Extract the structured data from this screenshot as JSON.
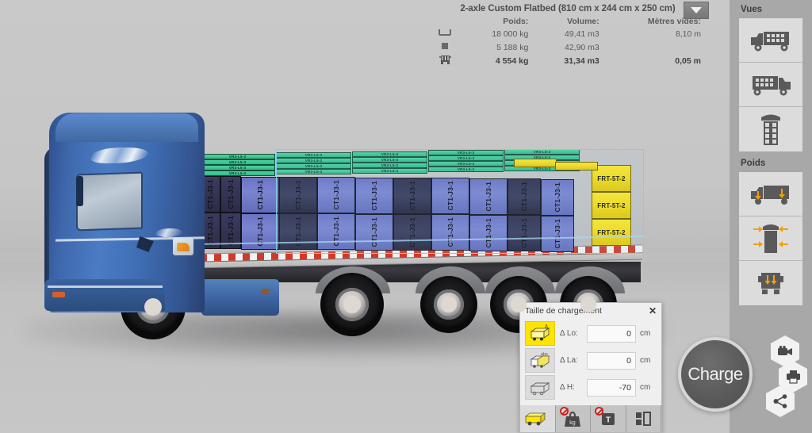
{
  "header": {
    "title": "2-axle Custom Flatbed (810 cm x 244 cm x 250 cm)",
    "columns": [
      "Poids:",
      "Volume:",
      "Mètres vides:"
    ],
    "rows": [
      {
        "icon": "trailer-capacity-icon",
        "poids": "18 000 kg",
        "volume": "49,41 m3",
        "metres": "8,10 m"
      },
      {
        "icon": "cargo-block-icon",
        "poids": "5 188 kg",
        "volume": "42,90 m3",
        "metres": ""
      },
      {
        "icon": "loaded-truck-icon",
        "poids": "4 554 kg",
        "volume": "31,34 m3",
        "metres": "0,05 m"
      }
    ],
    "dropdown_label": "chevron-down-icon"
  },
  "sidebar": {
    "views_title": "Vues",
    "views": [
      {
        "name": "view-side-right",
        "label": "Vue latérale droite"
      },
      {
        "name": "view-side-left",
        "label": "Vue latérale gauche"
      },
      {
        "name": "view-top",
        "label": "Vue de dessus"
      }
    ],
    "weights_title": "Poids",
    "weights": [
      {
        "name": "weight-axle-side",
        "label": "Poids par essieu (latéral)"
      },
      {
        "name": "weight-top",
        "label": "Poids (vue de dessus)"
      },
      {
        "name": "weight-rear",
        "label": "Poids (vue arrière)"
      }
    ]
  },
  "dialog": {
    "title": "Taille de chargement",
    "close_label": "✕",
    "modes": [
      {
        "name": "mode-relative",
        "label": "Δ",
        "active": true
      },
      {
        "name": "mode-absolute",
        "label": "abs",
        "active": false
      },
      {
        "name": "mode-wireframe",
        "label": "",
        "active": false
      }
    ],
    "fields": [
      {
        "label": "Δ Lo:",
        "value": "0",
        "unit": "cm",
        "name": "delta-length-input"
      },
      {
        "label": "Δ La:",
        "value": "0",
        "unit": "cm",
        "name": "delta-width-input"
      },
      {
        "label": "Δ H:",
        "value": "-70",
        "unit": "cm",
        "name": "delta-height-input"
      }
    ],
    "tabs": [
      {
        "name": "tab-load-size",
        "icon": "yellow-truck-icon",
        "active": true,
        "banned": false
      },
      {
        "name": "tab-weight",
        "icon": "weight-kg-icon",
        "active": false,
        "banned": true
      },
      {
        "name": "tab-temperature",
        "icon": "tonne-t-icon",
        "active": false,
        "banned": true
      },
      {
        "name": "tab-grouping",
        "icon": "split-boxes-icon",
        "active": false,
        "banned": false
      }
    ]
  },
  "actions": {
    "charge_label": "Charge",
    "hex_buttons": [
      {
        "name": "video-record-button",
        "icon": "video-camera-icon"
      },
      {
        "name": "print-button",
        "icon": "printer-icon"
      },
      {
        "name": "share-button",
        "icon": "share-icon"
      }
    ]
  },
  "cargo": {
    "green_label": "VR3-L5-3",
    "blue_label": "CT1-J3-1",
    "yellow_labels": [
      "FRT-5T-2",
      "FRT-5T-2",
      "FRT-5T-2"
    ],
    "colors": {
      "blue": "#6b74c4",
      "green": "#3fc894",
      "yellow": "#f7dc18",
      "selection": "#8ac8ef",
      "cab": "#3f6db3"
    }
  }
}
